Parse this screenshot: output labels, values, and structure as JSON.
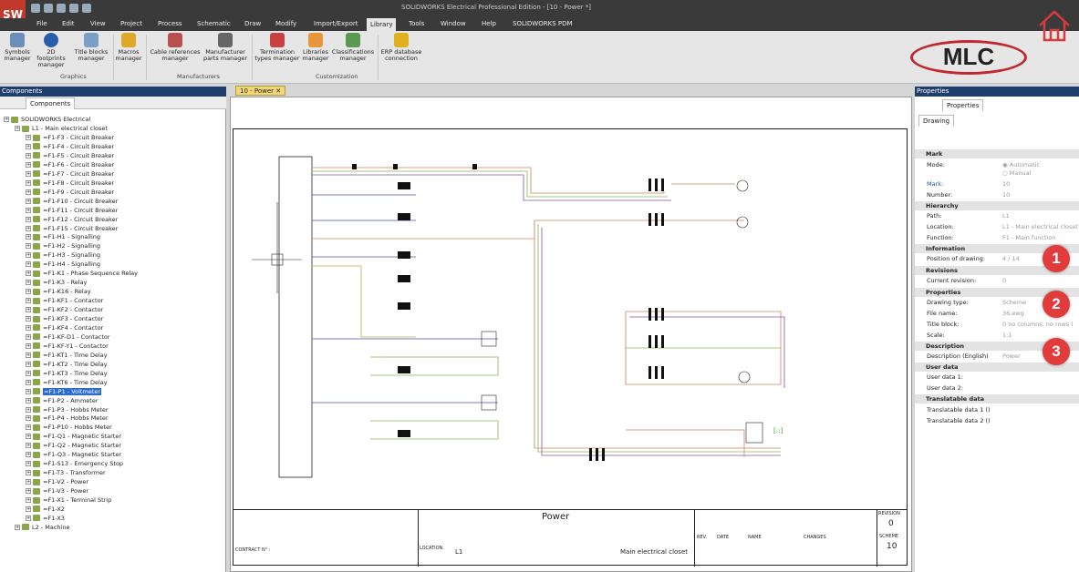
{
  "app": {
    "title": "SOLIDWORKS Electrical Professional Edition - [10 - Power *]"
  },
  "menu": [
    "File",
    "Edit",
    "View",
    "Project",
    "Process",
    "Schematic",
    "Draw",
    "Modify",
    "Import/Export",
    "Library",
    "Tools",
    "Window",
    "Help",
    "SOLIDWORKS PDM"
  ],
  "ribbon": {
    "buttons": [
      "Symbols manager",
      "2D footprints manager",
      "Title blocks manager",
      "Macros manager",
      "Cable references manager",
      "Manufacturer parts manager",
      "Termination types manager",
      "Libraries manager",
      "Classifications manager",
      "ERP database connection"
    ],
    "groups": [
      "Graphics",
      "Manufacturers",
      "Customization"
    ]
  },
  "brand": {
    "mlc": "MLC"
  },
  "components": {
    "panel_title": "Components",
    "tab": "Components",
    "root": "SOLIDWORKS Electrical",
    "location": "L1 - Main electrical closet",
    "items": [
      "=F1-F3 - Circuit Breaker",
      "=F1-F4 - Circuit Breaker",
      "=F1-F5 - Circuit Breaker",
      "=F1-F6 - Circuit Breaker",
      "=F1-F7 - Circuit Breaker",
      "=F1-F8 - Circuit Breaker",
      "=F1-F9 - Circuit Breaker",
      "=F1-F10 - Circuit Breaker",
      "=F1-F11 - Circuit Breaker",
      "=F1-F12 - Circuit Breaker",
      "=F1-F15 - Circuit Breaker",
      "=F1-H1 - Signalling",
      "=F1-H2 - Signalling",
      "=F1-H3 - Signalling",
      "=F1-H4 - Signalling",
      "=F1-K1 - Phase Sequence Relay",
      "=F1-K3 - Relay",
      "=F1-K16 - Relay",
      "=F1-KF1 - Contactor",
      "=F1-KF2 - Contactor",
      "=F1-KF3 - Contactor",
      "=F1-KF4 - Contactor",
      "=F1-KF-D1 - Contactor",
      "=F1-KF-Y1 - Contactor",
      "=F1-KT1 - Time Delay",
      "=F1-KT2 - Time Delay",
      "=F1-KT3 - Time Delay",
      "=F1-KT6 - Time Delay",
      "=F1-P1 - Voltmeter",
      "=F1-P2 - Ammeter",
      "=F1-P3 - Hobbs Meter",
      "=F1-P4 - Hobbs Meter",
      "=F1-P10 - Hobbs Meter",
      "=F1-Q1 - Magnetic Starter",
      "=F1-Q2 - Magnetic Starter",
      "=F1-Q3 - Magnetic Starter",
      "=F1-S13 - Emergency Stop",
      "=F1-T3 - Transformer",
      "=F1-V2 - Power",
      "=F1-V3 - Power",
      "=F1-X1 - Terminal Strip",
      "=F1-X2",
      "=F1-X3"
    ],
    "machine": "L2 - Machine"
  },
  "document": {
    "tab": "10 - Power",
    "titleblock": {
      "title": "Power",
      "revision_label": "REVISION",
      "revision": "0",
      "scheme_label": "SCHEME",
      "scheme": "10",
      "contract_label": "CONTRACT N° :",
      "location_label": "LOCATION",
      "location_code": "L1",
      "location": "Main electrical closet",
      "rev_head": [
        "REV.",
        "DATE",
        "NAME",
        "CHANGES"
      ]
    }
  },
  "properties": {
    "panel_title": "Properties",
    "tab": "Properties",
    "subtab": "Drawing",
    "sections": {
      "mark": "Mark",
      "hierarchy": "Hierarchy",
      "information": "Information",
      "revisions": "Revisions",
      "properties": "Properties",
      "description": "Description",
      "user_data": "User data",
      "translatable": "Translatable data"
    },
    "mode_label": "Mode:",
    "mode_auto": "Automatic",
    "mode_manual": "Manual",
    "mark_label": "Mark:",
    "mark": "10",
    "number_label": "Number:",
    "number": "10",
    "path_label": "Path:",
    "path": "L1",
    "location_label": "Location:",
    "location": "L1 - Main electrical closet",
    "function_label": "Function:",
    "function": "F1 - Main function",
    "position_label": "Position of drawing:",
    "position": "4 / 14",
    "revision_label": "Current revision:",
    "revision": "0",
    "drawing_type_label": "Drawing type:",
    "drawing_type": "Scheme",
    "file_label": "File name:",
    "file": "36.ewg",
    "titleblock_label": "Title block:",
    "titleblock": "0 no columns, no rows (",
    "scale_label": "Scale:",
    "scale": "1:1",
    "desc_label": "Description (English)",
    "desc": "Power",
    "user1": "User data 1:",
    "user2": "User data 2:",
    "trans1": "Translatable data 1 ()",
    "trans2": "Translatable data 2 ()"
  },
  "badges": [
    "1",
    "2",
    "3"
  ]
}
